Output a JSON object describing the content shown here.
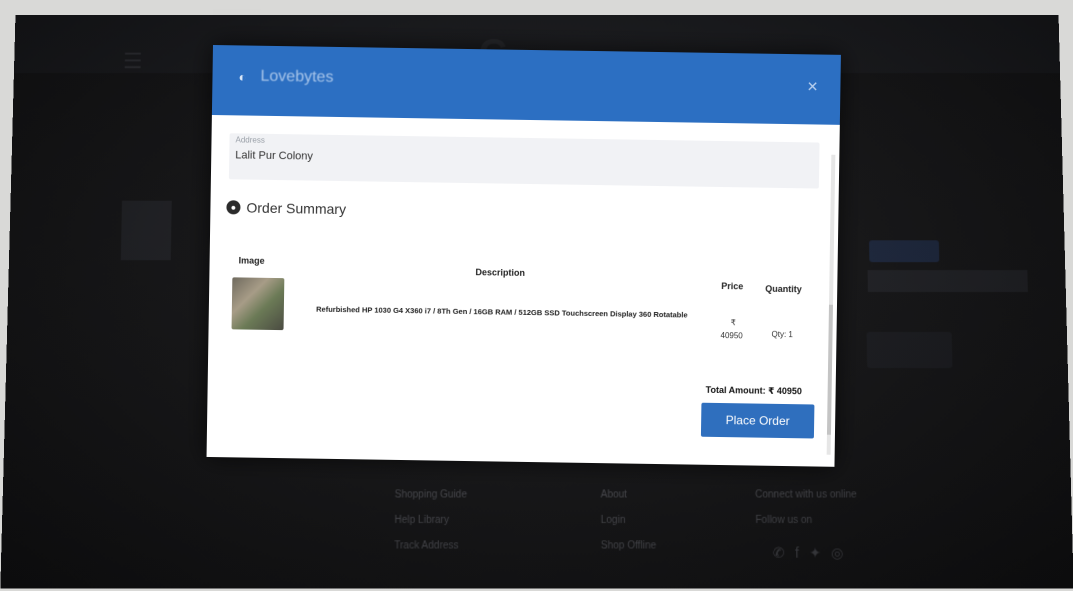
{
  "background": {
    "footer": {
      "col1": [
        "Shopping Guide",
        "Help Library",
        "Track Address"
      ],
      "col2": [
        "About",
        "Login",
        "Shop Offline"
      ],
      "col3": [
        "Connect with us online",
        "Follow us on"
      ],
      "social_icons": [
        "whatsapp-icon",
        "facebook-icon",
        "twitter-icon",
        "instagram-icon"
      ]
    }
  },
  "modal": {
    "title": "Lovebytes",
    "close_icon": "close-icon",
    "address": {
      "label": "Address",
      "value": "Lalit Pur Colony"
    },
    "summary_title": "Order Summary",
    "table": {
      "headers": {
        "image": "Image",
        "description": "Description",
        "price": "Price",
        "quantity": "Quantity"
      },
      "rows": [
        {
          "description": "Refurbished HP 1030 G4 X360 i7 / 8Th Gen / 16GB RAM / 512GB SSD Touchscreen Display 360 Rotatable",
          "price_symbol": "₹",
          "price": "40950",
          "quantity": "Qty: 1"
        }
      ]
    },
    "total": {
      "label": "Total Amount:",
      "value": "₹ 40950"
    },
    "place_order_label": "Place Order"
  },
  "colors": {
    "header_blue": "#2c6fc2",
    "button_blue": "#2f6fbe",
    "screen_dark": "#151517"
  }
}
